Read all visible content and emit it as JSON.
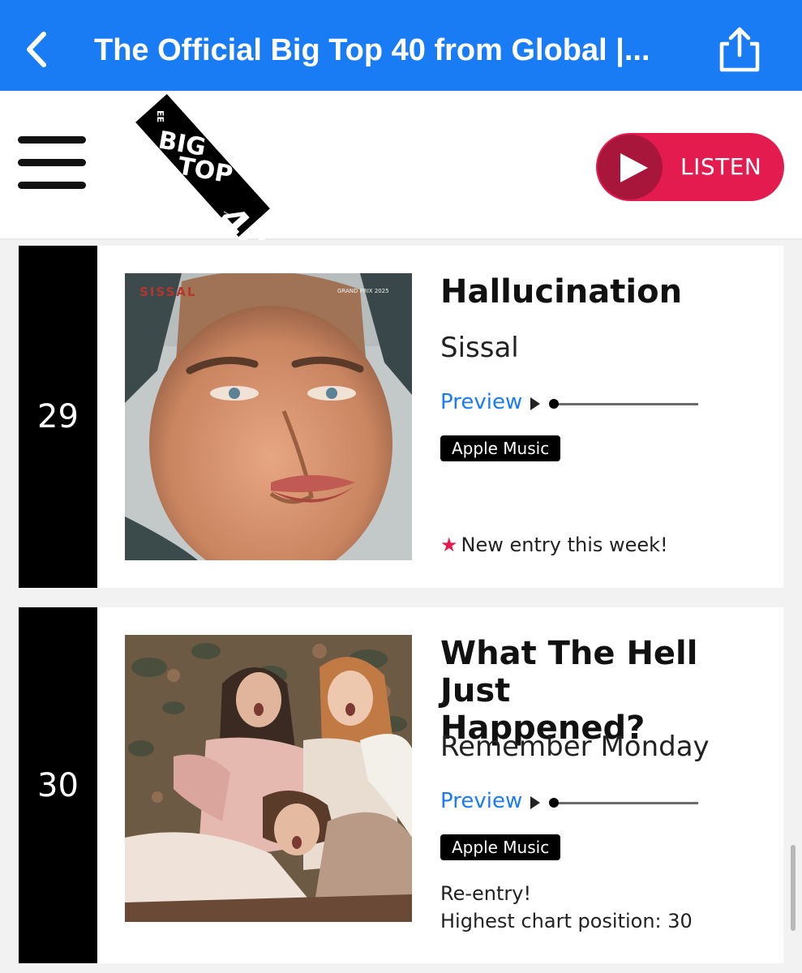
{
  "navbar": {
    "title": "The Official Big Top 40 from Global |...",
    "back_icon": "chevron-left-icon",
    "share_icon": "share-icon",
    "color": "#1a7cf5"
  },
  "header": {
    "menu_icon": "hamburger-menu-icon",
    "logo": {
      "line1": "BIG",
      "line2": "TOP",
      "number": "40",
      "official": "OFFICIAL",
      "ee": "EE",
      "brand": "global"
    },
    "listen_label": "LISTEN",
    "listen_color": "#e31b4f"
  },
  "entries": [
    {
      "position": "29",
      "title": "Hallucination",
      "artist": "Sissal",
      "preview_label": "Preview",
      "preview_progress": 0,
      "badge": "Apple Music",
      "note": "New entry this week!",
      "art_text": "SISSAL",
      "art_badge": "GRAND PRIX 2025"
    },
    {
      "position": "30",
      "title_line1": "What The Hell Just",
      "title_line2": "Happened?",
      "artist": "Remember Monday",
      "preview_label": "Preview",
      "preview_progress": 0,
      "badge": "Apple Music",
      "note_line1": "Re-entry!",
      "note_line2": "Highest chart position: 30"
    }
  ]
}
